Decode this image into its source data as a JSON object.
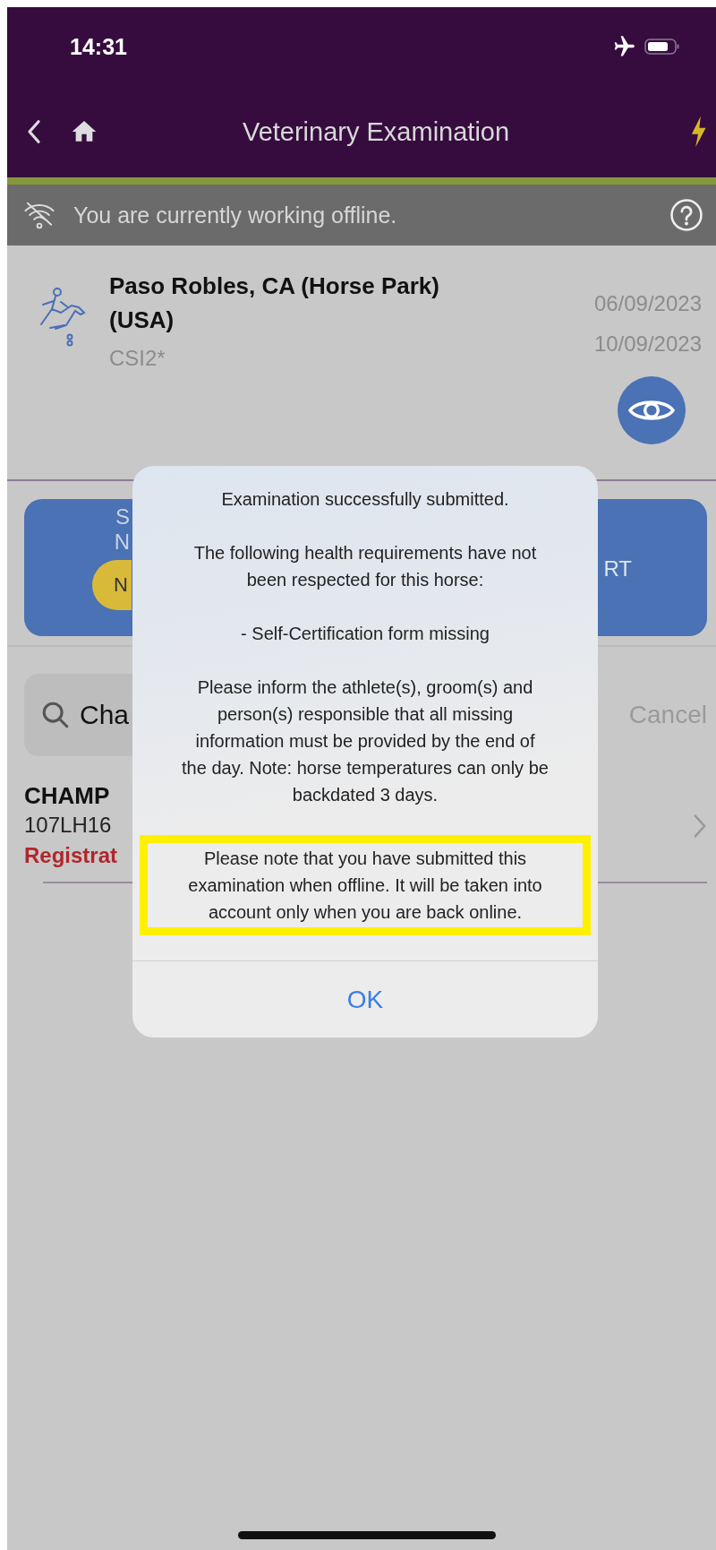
{
  "status_bar": {
    "time": "14:31"
  },
  "nav_bar": {
    "title": "Veterinary Examination"
  },
  "offline_banner": {
    "message": "You are currently working offline."
  },
  "event": {
    "name": "Paso Robles, CA (Horse Park) (USA)",
    "category": "CSI2*",
    "start_date": "06/09/2023",
    "end_date": "10/09/2023"
  },
  "action_panel": {
    "line_1": "S",
    "line_2": "N",
    "badge": "N",
    "right_label": "RT"
  },
  "search": {
    "value": "Cha",
    "cancel": "Cancel"
  },
  "results": [
    {
      "title": "CHAMP",
      "subtitle": "107LH16",
      "status": "Registrat"
    }
  ],
  "dialog": {
    "paragraphs": [
      "Examination successfully submitted.",
      "The following health requirements have not been respected for this horse:",
      "- Self-Certification form missing",
      "Please inform the athlete(s), groom(s) and person(s) responsible that all missing information must be provided by the end of the day. Note: horse temperatures can only be backdated 3 days."
    ],
    "highlighted_note": "Please note that you have submitted this examination when offline. It will be taken into account only when you are back online.",
    "button": "OK"
  }
}
